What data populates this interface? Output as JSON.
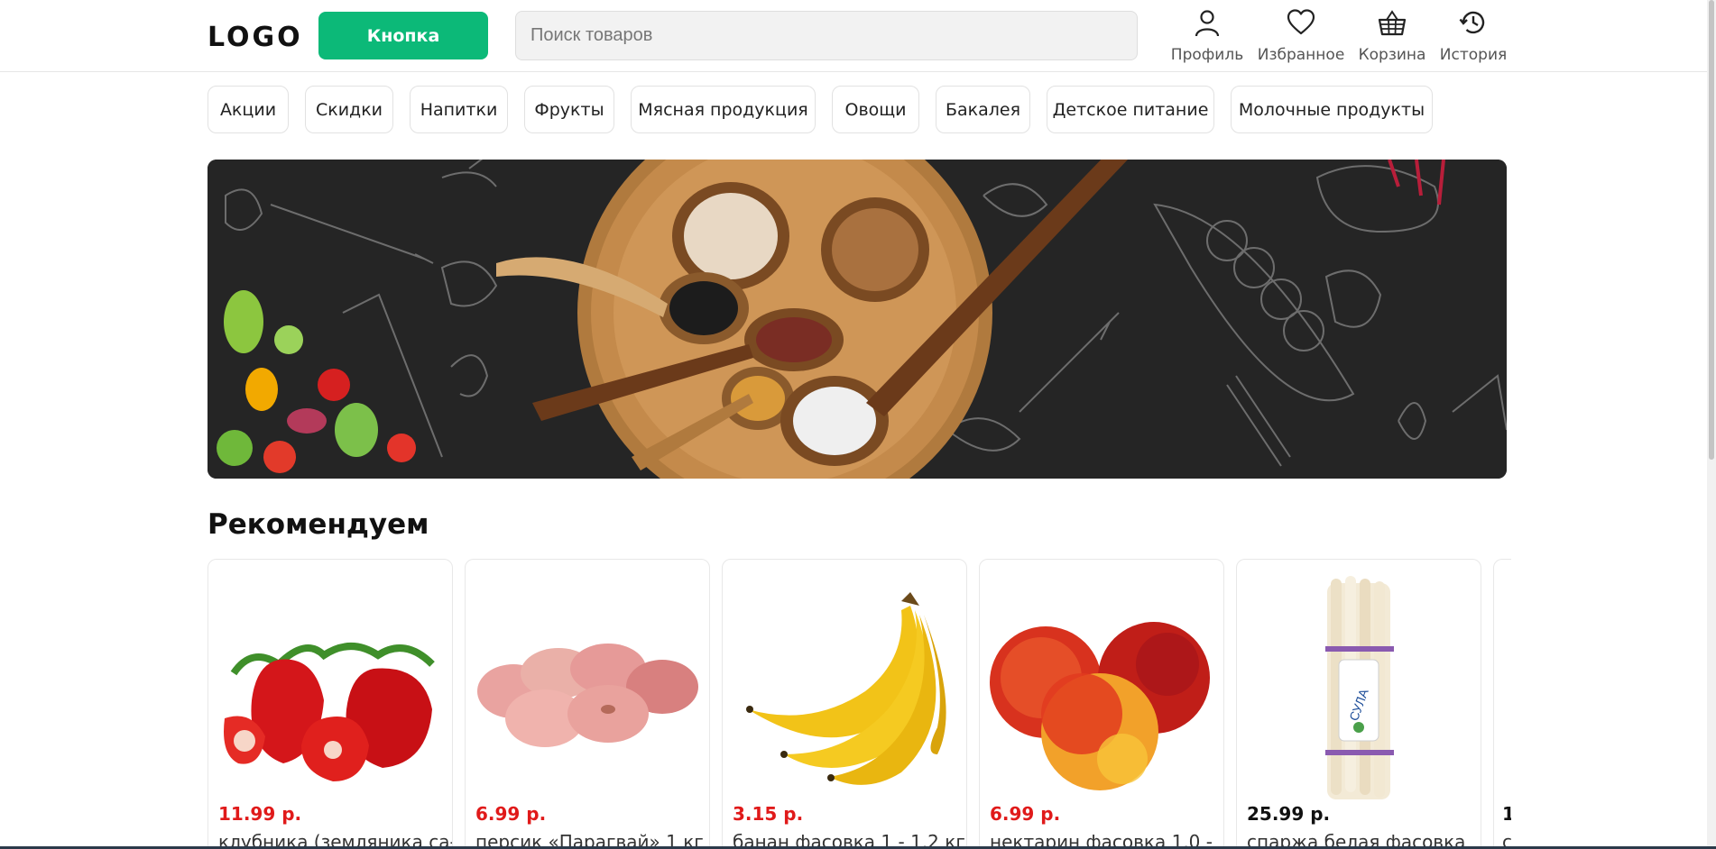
{
  "header": {
    "logo": "LOGO",
    "button_label": "Кнопка",
    "search_placeholder": "Поиск товаров",
    "nav": [
      {
        "icon": "user-icon",
        "label": "Профиль"
      },
      {
        "icon": "heart-icon",
        "label": "Избранное"
      },
      {
        "icon": "basket-icon",
        "label": "Корзина"
      },
      {
        "icon": "history-icon",
        "label": "История"
      }
    ]
  },
  "categories": [
    "Акции",
    "Скидки",
    "Напитки",
    "Фрукты",
    "Мясная продукция",
    "Овощи",
    "Бакалея",
    "Детское питание",
    "Молочные продукты"
  ],
  "banner": {
    "image": "spices-wooden-spoons-banner"
  },
  "section": {
    "title": "Рекомендуем",
    "products": [
      {
        "image": "strawberry",
        "price": "11.99 р.",
        "price_color": "#e01a1a",
        "name": "клубника (земляника са-"
      },
      {
        "image": "peach",
        "price": "6.99 р.",
        "price_color": "#e01a1a",
        "name": "персик «Парагвай» 1 кг"
      },
      {
        "image": "banana",
        "price": "3.15 р.",
        "price_color": "#e01a1a",
        "name": "банан фасовка 1 - 1,2 кг"
      },
      {
        "image": "nectarine",
        "price": "6.99 р.",
        "price_color": "#e01a1a",
        "name": "нектарин фасовка 1,0 -"
      },
      {
        "image": "asparagus",
        "price": "25.99 р.",
        "price_color": "#111111",
        "name": "спаржа белая фасовка"
      },
      {
        "image": "partial",
        "price": "1",
        "price_color": "#111111",
        "name": "с"
      }
    ],
    "asparagus_brand": "СУЛА"
  },
  "colors": {
    "accent": "#0cb978",
    "sale_price": "#e01a1a"
  }
}
